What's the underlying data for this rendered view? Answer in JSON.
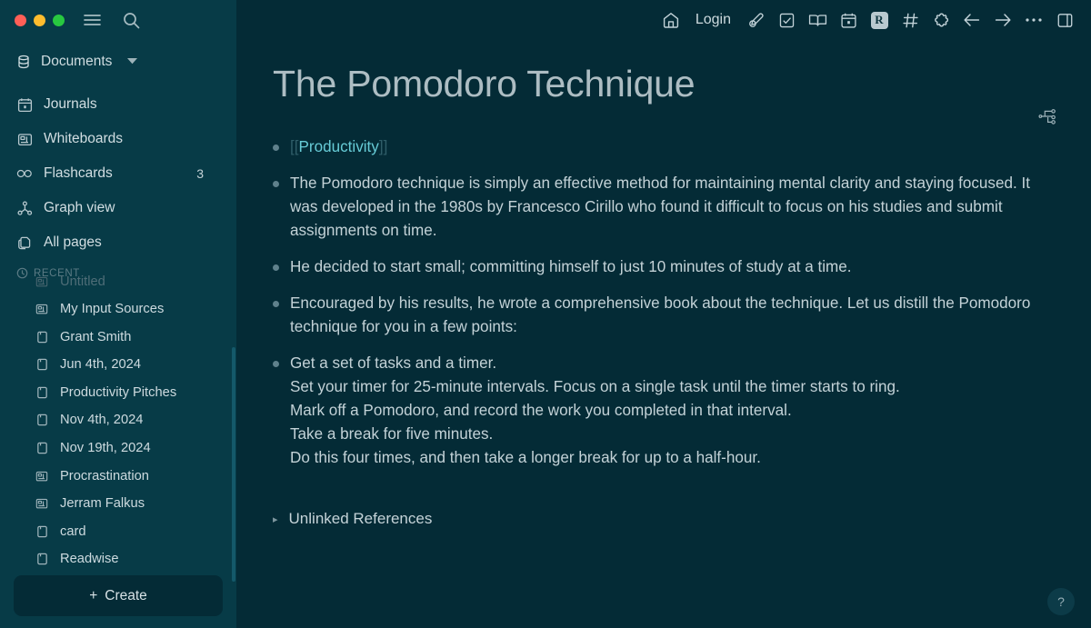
{
  "window": {
    "controls": [
      "close",
      "minimize",
      "maximize"
    ],
    "menu_icon": "hamburger-menu-icon",
    "search_icon": "search-icon"
  },
  "sidebar": {
    "graph_selector": {
      "label": "Documents",
      "icon": "database-icon",
      "caret": "chevron-down-icon"
    },
    "nav": [
      {
        "label": "Journals",
        "icon": "calendar-icon",
        "badge": ""
      },
      {
        "label": "Whiteboards",
        "icon": "whiteboard-icon",
        "badge": ""
      },
      {
        "label": "Flashcards",
        "icon": "infinity-icon",
        "badge": "3"
      },
      {
        "label": "Graph view",
        "icon": "graph-icon",
        "badge": ""
      },
      {
        "label": "All pages",
        "icon": "pages-icon",
        "badge": ""
      }
    ],
    "recent": {
      "header": "RECENT",
      "header_icon": "history-clock-icon",
      "items": [
        {
          "label": "Untitled",
          "icon": "whiteboard-icon"
        },
        {
          "label": "My Input Sources",
          "icon": "whiteboard-icon"
        },
        {
          "label": "Grant Smith",
          "icon": "page-icon"
        },
        {
          "label": "Jun 4th, 2024",
          "icon": "page-icon"
        },
        {
          "label": "Productivity Pitches",
          "icon": "page-icon"
        },
        {
          "label": "Nov 4th, 2024",
          "icon": "page-icon"
        },
        {
          "label": "Nov 19th, 2024",
          "icon": "page-icon"
        },
        {
          "label": "Procrastination",
          "icon": "whiteboard-icon"
        },
        {
          "label": "Jerram Falkus",
          "icon": "whiteboard-icon"
        },
        {
          "label": "card",
          "icon": "page-icon"
        },
        {
          "label": "Readwise",
          "icon": "page-icon"
        }
      ]
    },
    "create_button": {
      "label": "Create",
      "plus": "+"
    }
  },
  "toolbar": {
    "home_icon": "home-icon",
    "login_label": "Login",
    "items": [
      "edit-pencil-icon",
      "checkbox-icon",
      "book-icon",
      "calendar-icon",
      "readwise-r-badge",
      "hash-icon",
      "puzzle-plugin-icon",
      "arrow-left-icon",
      "arrow-right-icon",
      "more-dots-icon",
      "right-sidebar-icon"
    ],
    "r_badge_text": "R"
  },
  "page": {
    "title": "The Pomodoro Technique",
    "title_tool_icon": "hierarchy-icon",
    "bullets": [
      {
        "type": "link",
        "open_brackets": "[[",
        "link": "Productivity",
        "close_brackets": "]]"
      },
      {
        "type": "text",
        "lines": [
          "The Pomodoro technique is simply an effective method for maintaining mental clarity and staying focused. It was developed in the 1980s by Francesco Cirillo who found it difficult to focus on his studies and submit assignments on time."
        ]
      },
      {
        "type": "text",
        "lines": [
          "He decided to start small; committing himself to just 10 minutes of study at a time."
        ]
      },
      {
        "type": "text",
        "lines": [
          "Encouraged by his results, he wrote a comprehensive book about the technique. Let us distill the Pomodoro technique for you in a few points:"
        ]
      },
      {
        "type": "multiline",
        "lines": [
          "Get a set of tasks and a timer.",
          "Set your timer for 25-minute intervals. Focus on a single task until the timer starts to ring.",
          "Mark off a Pomodoro, and record the work you completed in that interval.",
          "Take a break for five minutes.",
          "Do this four times, and then take a longer break for up to a half-hour."
        ]
      }
    ],
    "unlinked_references": {
      "label": "Unlinked References",
      "toggle": "▸"
    },
    "help_button": "?"
  },
  "colors": {
    "sidebar_bg": "#073b47",
    "main_bg": "#042b36",
    "text": "#c3d2d7",
    "link_accent": "#67cbd6",
    "scrollbar": "#14596a",
    "traffic_red": "#ff5f57",
    "traffic_yellow": "#febc2e",
    "traffic_green": "#28c840"
  }
}
